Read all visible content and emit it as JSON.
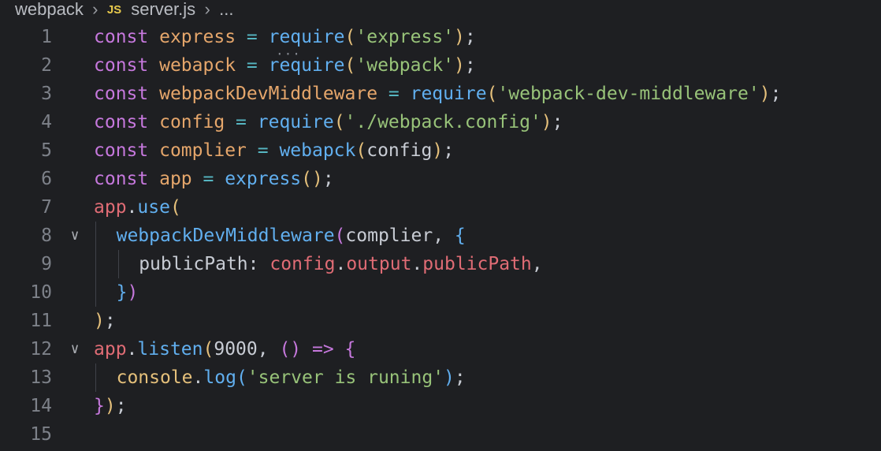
{
  "breadcrumb": {
    "folder": "webpack",
    "file_icon": "JS",
    "file": "server.js",
    "more": "..."
  },
  "editor": {
    "language": "javascript",
    "lines": [
      {
        "n": "1",
        "fold": "",
        "indent": 0,
        "tokens": [
          {
            "t": "const",
            "c": "kw"
          },
          {
            "t": " ",
            "c": "plain"
          },
          {
            "t": "express",
            "c": "var"
          },
          {
            "t": " = ",
            "c": "op"
          },
          {
            "t": "require",
            "c": "fn"
          },
          {
            "t": "(",
            "c": "p1"
          },
          {
            "t": "'express'",
            "c": "str"
          },
          {
            "t": ")",
            "c": "p1"
          },
          {
            "t": ";",
            "c": "plain"
          }
        ]
      },
      {
        "n": "2",
        "fold": "",
        "indent": 0,
        "tokens": [
          {
            "t": "const",
            "c": "kw"
          },
          {
            "t": " ",
            "c": "plain"
          },
          {
            "t": "webapck",
            "c": "var"
          },
          {
            "t": " = ",
            "c": "op"
          },
          {
            "t": "require",
            "c": "fn"
          },
          {
            "t": "(",
            "c": "p1"
          },
          {
            "t": "'webpack'",
            "c": "str"
          },
          {
            "t": ")",
            "c": "p1"
          },
          {
            "t": ";",
            "c": "plain"
          }
        ]
      },
      {
        "n": "3",
        "fold": "",
        "indent": 0,
        "tokens": [
          {
            "t": "const",
            "c": "kw"
          },
          {
            "t": " ",
            "c": "plain"
          },
          {
            "t": "webpackDevMiddleware",
            "c": "var"
          },
          {
            "t": " = ",
            "c": "op"
          },
          {
            "t": "require",
            "c": "fn"
          },
          {
            "t": "(",
            "c": "p1"
          },
          {
            "t": "'webpack-dev-middleware'",
            "c": "str"
          },
          {
            "t": ")",
            "c": "p1"
          },
          {
            "t": ";",
            "c": "plain"
          }
        ]
      },
      {
        "n": "4",
        "fold": "",
        "indent": 0,
        "tokens": [
          {
            "t": "const",
            "c": "kw"
          },
          {
            "t": " ",
            "c": "plain"
          },
          {
            "t": "config",
            "c": "var"
          },
          {
            "t": " = ",
            "c": "op"
          },
          {
            "t": "require",
            "c": "fn"
          },
          {
            "t": "(",
            "c": "p1"
          },
          {
            "t": "'./webpack.config'",
            "c": "str"
          },
          {
            "t": ")",
            "c": "p1"
          },
          {
            "t": ";",
            "c": "plain"
          }
        ]
      },
      {
        "n": "5",
        "fold": "",
        "indent": 0,
        "tokens": [
          {
            "t": "const",
            "c": "kw"
          },
          {
            "t": " ",
            "c": "plain"
          },
          {
            "t": "complier",
            "c": "var"
          },
          {
            "t": " = ",
            "c": "op"
          },
          {
            "t": "webapck",
            "c": "fn"
          },
          {
            "t": "(",
            "c": "p1"
          },
          {
            "t": "config",
            "c": "plain"
          },
          {
            "t": ")",
            "c": "p1"
          },
          {
            "t": ";",
            "c": "plain"
          }
        ]
      },
      {
        "n": "6",
        "fold": "",
        "indent": 0,
        "tokens": [
          {
            "t": "const",
            "c": "kw"
          },
          {
            "t": " ",
            "c": "plain"
          },
          {
            "t": "app",
            "c": "var"
          },
          {
            "t": " = ",
            "c": "op"
          },
          {
            "t": "express",
            "c": "fn"
          },
          {
            "t": "()",
            "c": "p1"
          },
          {
            "t": ";",
            "c": "plain"
          }
        ]
      },
      {
        "n": "7",
        "fold": "",
        "indent": 0,
        "tokens": [
          {
            "t": "app",
            "c": "obj"
          },
          {
            "t": ".",
            "c": "plain"
          },
          {
            "t": "use",
            "c": "fn"
          },
          {
            "t": "(",
            "c": "p1"
          }
        ]
      },
      {
        "n": "8",
        "fold": "∨",
        "indent": 1,
        "tokens": [
          {
            "t": "webpackDevMiddleware",
            "c": "fn"
          },
          {
            "t": "(",
            "c": "p2"
          },
          {
            "t": "complier",
            "c": "plain"
          },
          {
            "t": ", ",
            "c": "plain"
          },
          {
            "t": "{",
            "c": "p3"
          }
        ]
      },
      {
        "n": "9",
        "fold": "",
        "indent": 2,
        "tokens": [
          {
            "t": "publicPath",
            "c": "plain"
          },
          {
            "t": ": ",
            "c": "plain"
          },
          {
            "t": "config",
            "c": "obj"
          },
          {
            "t": ".",
            "c": "plain"
          },
          {
            "t": "output",
            "c": "obj"
          },
          {
            "t": ".",
            "c": "plain"
          },
          {
            "t": "publicPath",
            "c": "obj"
          },
          {
            "t": ",",
            "c": "plain"
          }
        ]
      },
      {
        "n": "10",
        "fold": "",
        "indent": 1,
        "tokens": [
          {
            "t": "}",
            "c": "p3"
          },
          {
            "t": ")",
            "c": "p2"
          }
        ]
      },
      {
        "n": "11",
        "fold": "",
        "indent": 0,
        "tokens": [
          {
            "t": ")",
            "c": "p1"
          },
          {
            "t": ";",
            "c": "plain"
          }
        ]
      },
      {
        "n": "12",
        "fold": "∨",
        "indent": 0,
        "tokens": [
          {
            "t": "app",
            "c": "obj"
          },
          {
            "t": ".",
            "c": "plain"
          },
          {
            "t": "listen",
            "c": "fn"
          },
          {
            "t": "(",
            "c": "p1"
          },
          {
            "t": "9000",
            "c": "num"
          },
          {
            "t": ", ",
            "c": "plain"
          },
          {
            "t": "()",
            "c": "p2"
          },
          {
            "t": " => ",
            "c": "kw"
          },
          {
            "t": "{",
            "c": "p2"
          }
        ]
      },
      {
        "n": "13",
        "fold": "",
        "indent": 1,
        "tokens": [
          {
            "t": "console",
            "c": "p1"
          },
          {
            "t": ".",
            "c": "plain"
          },
          {
            "t": "log",
            "c": "fn"
          },
          {
            "t": "(",
            "c": "p3"
          },
          {
            "t": "'server is runing'",
            "c": "str"
          },
          {
            "t": ")",
            "c": "p3"
          },
          {
            "t": ";",
            "c": "plain"
          }
        ]
      },
      {
        "n": "14",
        "fold": "",
        "indent": 0,
        "tokens": [
          {
            "t": "}",
            "c": "p2"
          },
          {
            "t": ")",
            "c": "p1"
          },
          {
            "t": ";",
            "c": "plain"
          }
        ]
      },
      {
        "n": "15",
        "fold": "",
        "indent": 0,
        "tokens": []
      }
    ]
  }
}
